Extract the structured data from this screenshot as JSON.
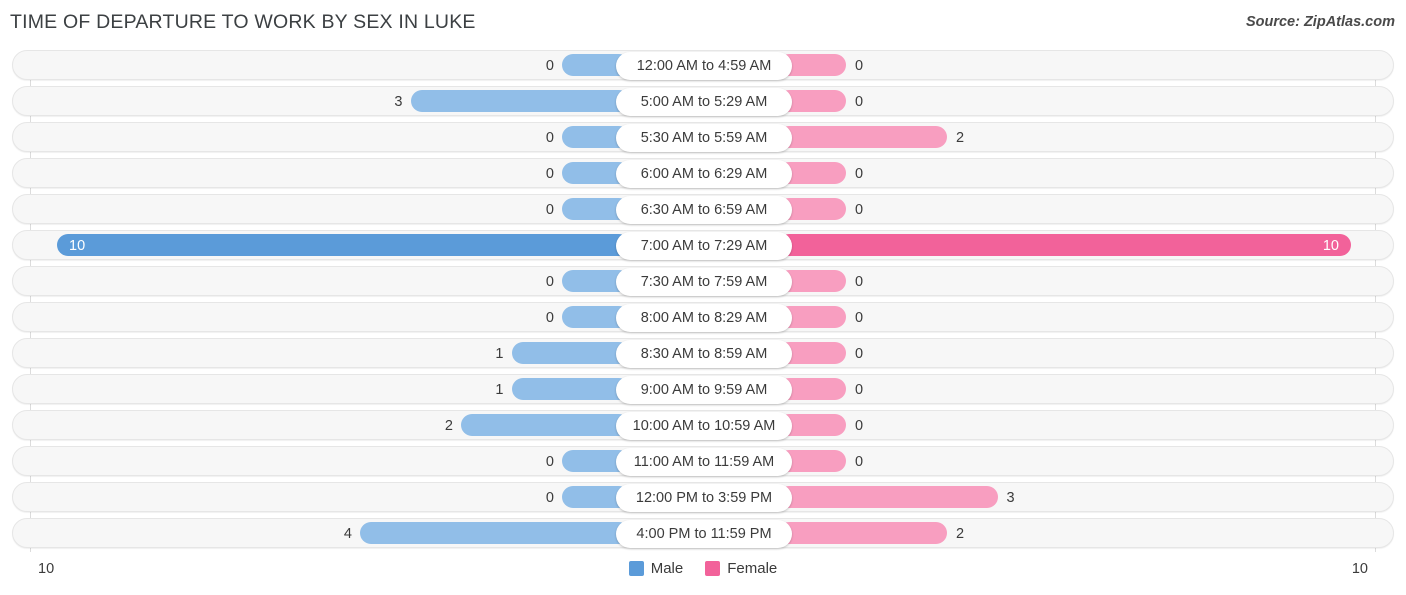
{
  "header": {
    "title": "TIME OF DEPARTURE TO WORK BY SEX IN LUKE",
    "source": "Source: ZipAtlas.com"
  },
  "footer": {
    "axis_left": "10",
    "axis_right": "10",
    "legend": [
      {
        "label": "Male",
        "color": "#5b9bd9"
      },
      {
        "label": "Female",
        "color": "#f2629a"
      }
    ]
  },
  "chart_data": {
    "type": "bar",
    "orientation": "horizontal-diverging",
    "title": "TIME OF DEPARTURE TO WORK BY SEX IN LUKE",
    "xlabel": "",
    "ylabel": "",
    "axis_max": 10,
    "xlim": [
      10,
      10
    ],
    "grid": true,
    "legend_position": "bottom-center",
    "categories": [
      "12:00 AM to 4:59 AM",
      "5:00 AM to 5:29 AM",
      "5:30 AM to 5:59 AM",
      "6:00 AM to 6:29 AM",
      "6:30 AM to 6:59 AM",
      "7:00 AM to 7:29 AM",
      "7:30 AM to 7:59 AM",
      "8:00 AM to 8:29 AM",
      "8:30 AM to 8:59 AM",
      "9:00 AM to 9:59 AM",
      "10:00 AM to 10:59 AM",
      "11:00 AM to 11:59 AM",
      "12:00 PM to 3:59 PM",
      "4:00 PM to 11:59 PM"
    ],
    "series": [
      {
        "name": "Male",
        "side": "left",
        "color": "#91bee8",
        "max_color": "#5b9bd9",
        "values": [
          0,
          3,
          0,
          0,
          0,
          10,
          0,
          0,
          1,
          1,
          2,
          0,
          0,
          4
        ]
      },
      {
        "name": "Female",
        "side": "right",
        "color": "#f89ec0",
        "max_color": "#f2629a",
        "values": [
          0,
          0,
          2,
          0,
          0,
          10,
          0,
          0,
          0,
          0,
          0,
          0,
          3,
          2
        ]
      }
    ]
  }
}
